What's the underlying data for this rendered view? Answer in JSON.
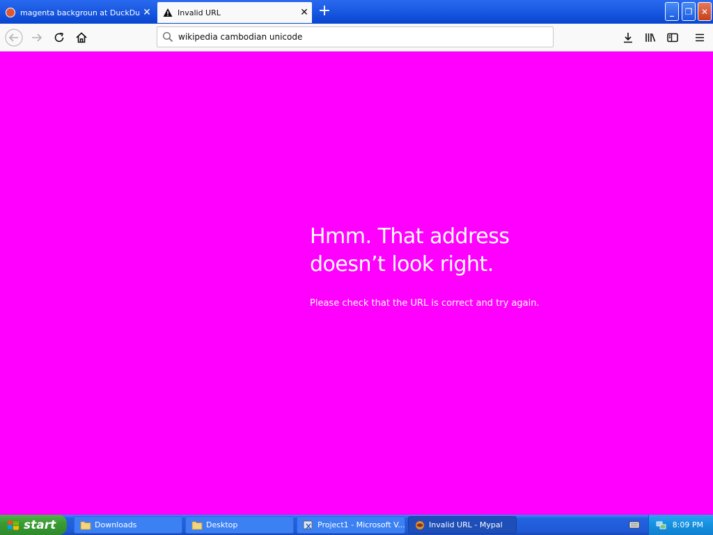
{
  "tabs": [
    {
      "title": "magenta backgroun at DuckDuckG",
      "favicon": "duckduckgo-icon",
      "active": false
    },
    {
      "title": "Invalid URL",
      "favicon": "warning-icon",
      "active": true
    }
  ],
  "newtab": {
    "label": "+"
  },
  "window_controls": {
    "minimize": "_",
    "maximize": "❐",
    "close": "✕"
  },
  "toolbar": {
    "url_value": "wikipedia cambodian unicode"
  },
  "page": {
    "background": "#ff00ff",
    "title_line1": "Hmm. That address",
    "title_line2": "doesn’t look right.",
    "description": "Please check that the URL is correct and try again."
  },
  "taskbar": {
    "start_label": "start",
    "buttons": [
      {
        "label": "Downloads",
        "icon": "folder-icon"
      },
      {
        "label": "Desktop",
        "icon": "folder-icon"
      },
      {
        "label": "Project1 - Microsoft V...",
        "icon": "visual-basic-icon"
      },
      {
        "label": "Invalid URL - Mypal",
        "icon": "mypal-icon",
        "active": true
      }
    ],
    "clock": "8:09 PM"
  }
}
